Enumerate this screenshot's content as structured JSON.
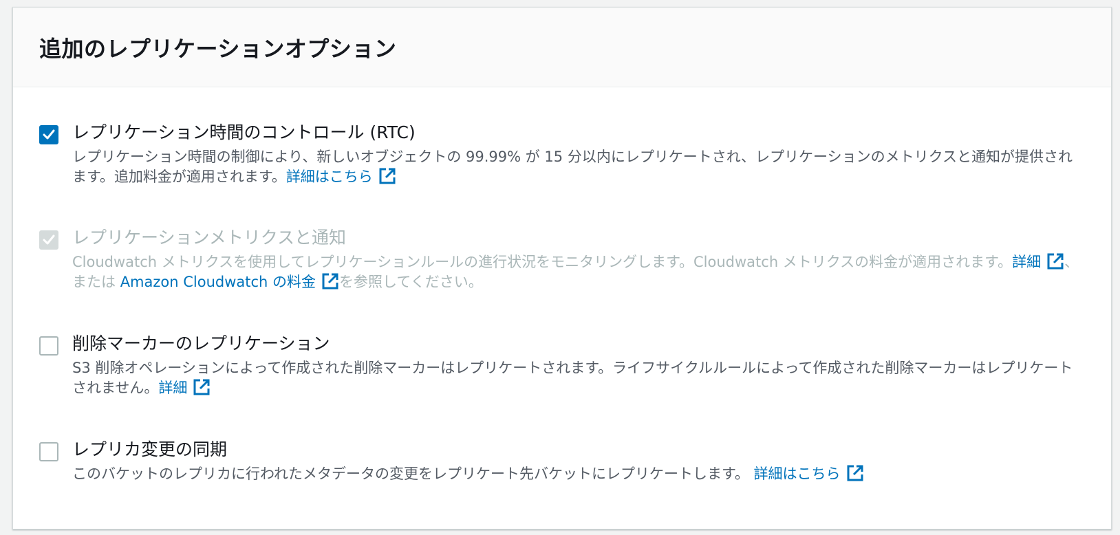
{
  "panel": {
    "title": "追加のレプリケーションオプション"
  },
  "options": [
    {
      "label": "レプリケーション時間のコントロール (RTC)",
      "checked": true,
      "disabled": false,
      "description": "レプリケーション時間の制御により、新しいオブジェクトの 99.99% が 15 分以内にレプリケートされ、レプリケーションのメトリクスと通知が提供されます。追加料金が適用されます。",
      "link": "詳細はこちら"
    },
    {
      "label": "レプリケーションメトリクスと通知",
      "checked": true,
      "disabled": true,
      "description_part1": "Cloudwatch メトリクスを使用してレプリケーションルールの進行状況をモニタリングします。Cloudwatch メトリクスの料金が適用されます。",
      "link1": "詳細",
      "between": "、または ",
      "link2": "Amazon Cloudwatch の料金",
      "description_part2": "を参照してください。"
    },
    {
      "label": "削除マーカーのレプリケーション",
      "checked": false,
      "disabled": false,
      "description": "S3 削除オペレーションによって作成された削除マーカーはレプリケートされます。ライフサイクルルールによって作成された削除マーカーはレプリケートされません。",
      "link": "詳細"
    },
    {
      "label": "レプリカ変更の同期",
      "checked": false,
      "disabled": false,
      "description": "このバケットのレプリカに行われたメタデータの変更をレプリケート先バケットにレプリケートします。 ",
      "link": "詳細はこちら"
    }
  ],
  "colors": {
    "accent": "#0073bb",
    "disabled": "#aab7b8",
    "text": "#16191f",
    "secondary_text": "#545b64"
  }
}
